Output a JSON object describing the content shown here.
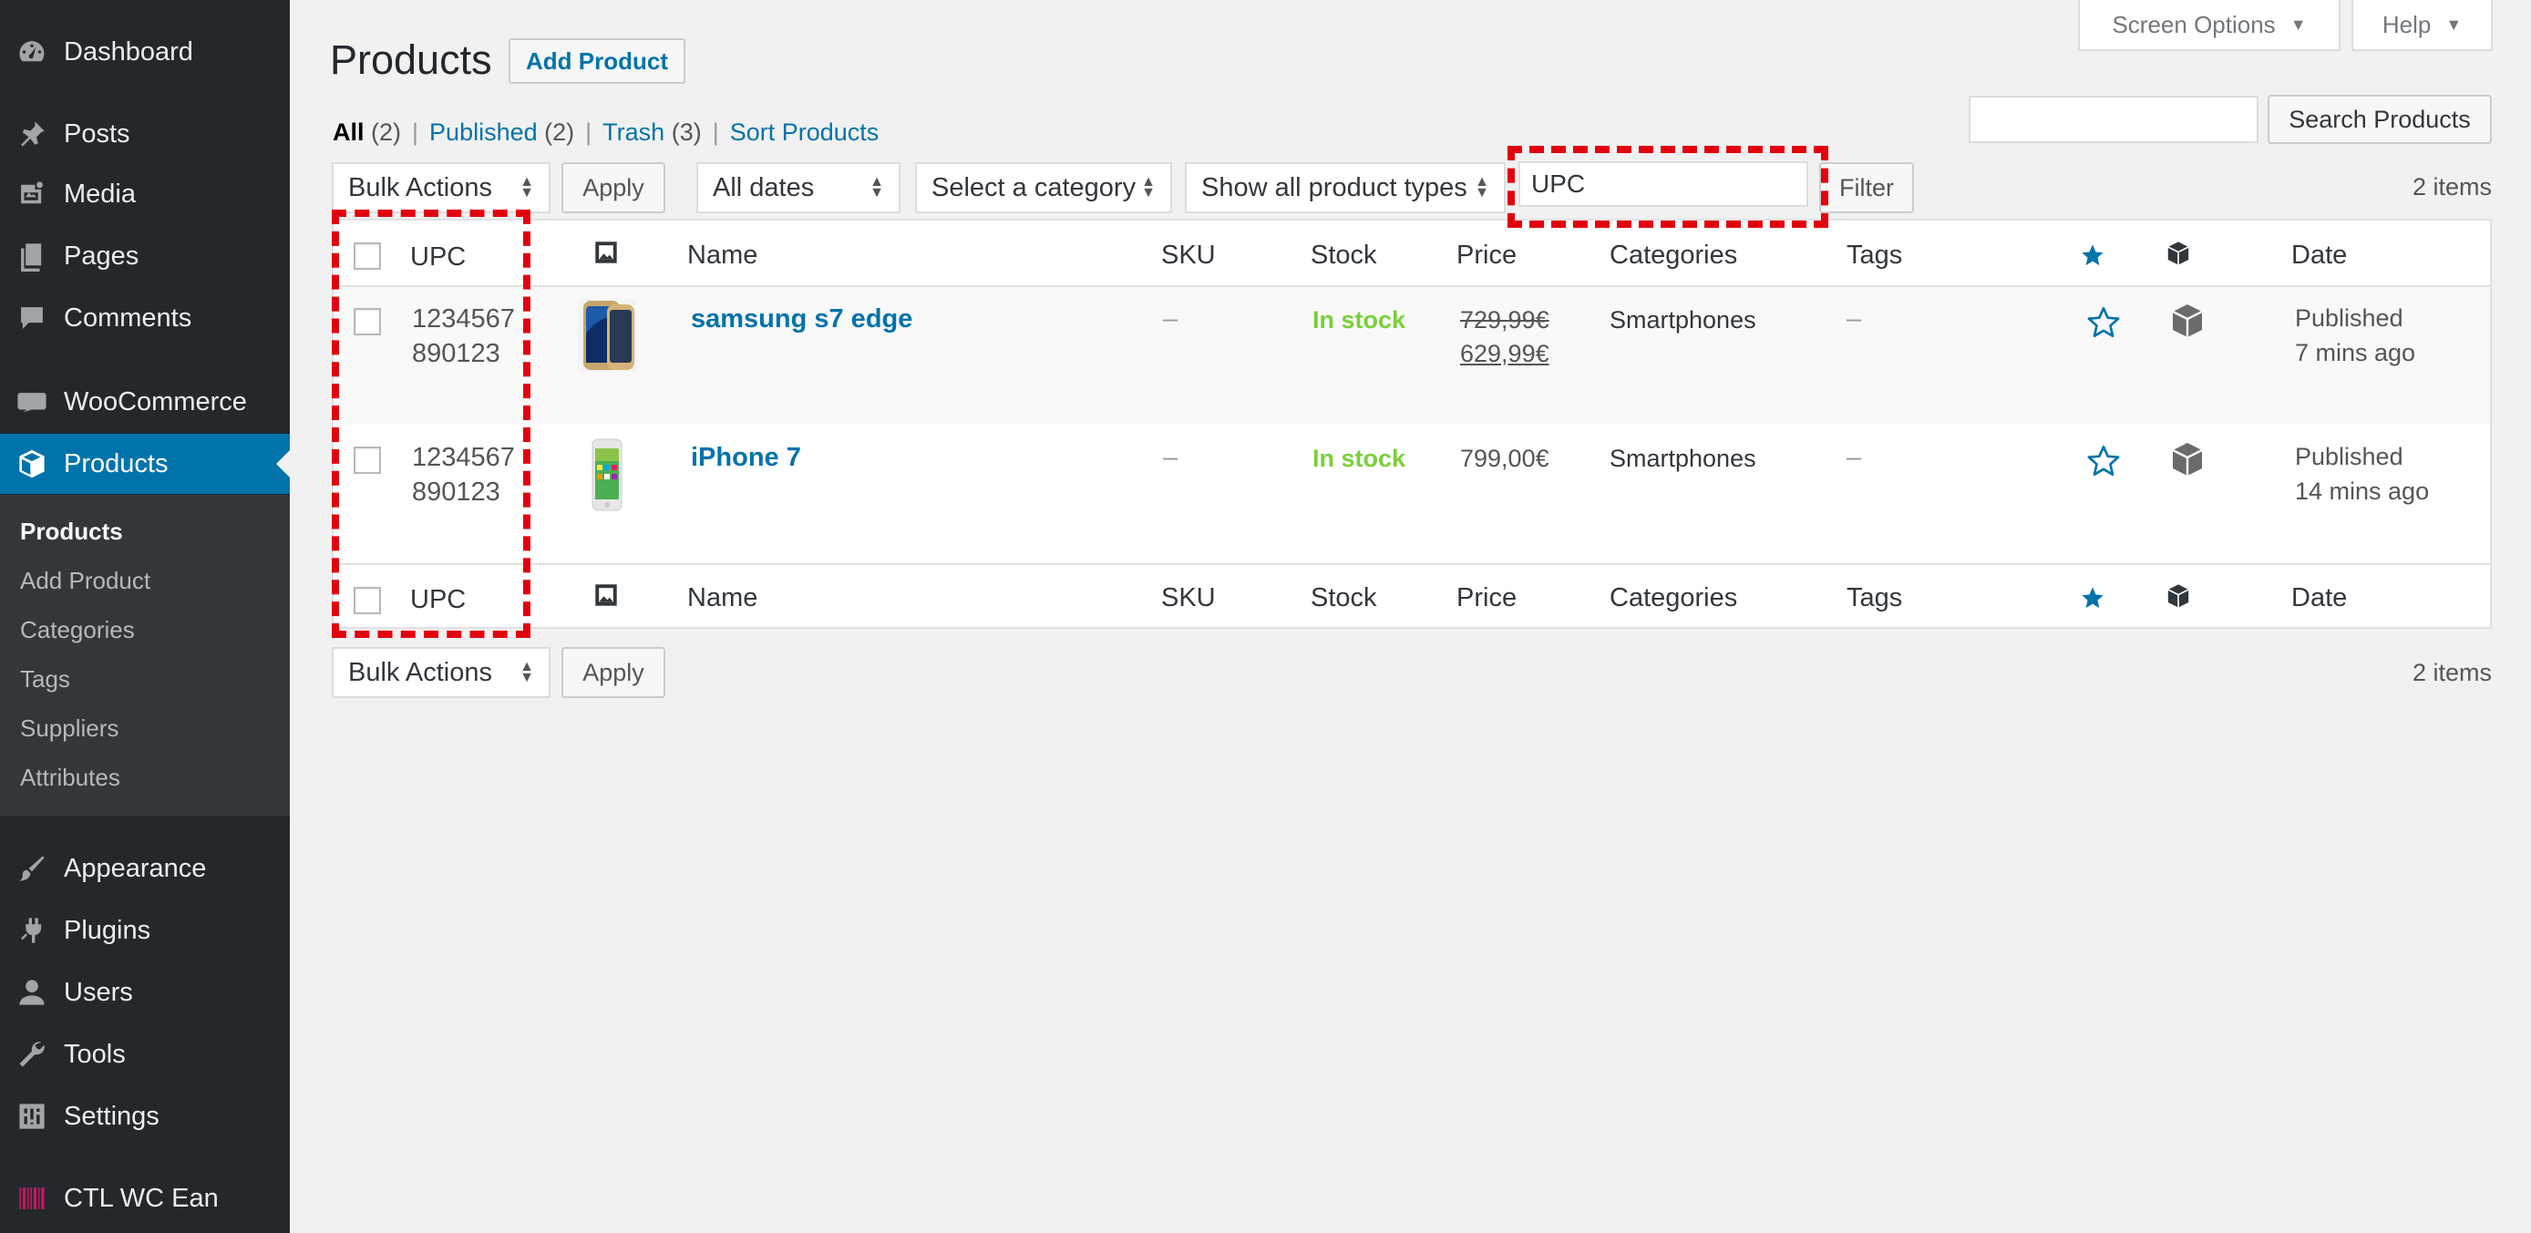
{
  "sidebar": {
    "items": [
      {
        "label": "Dashboard",
        "icon": "dashboard-icon"
      },
      {
        "label": "Posts",
        "icon": "pin-icon"
      },
      {
        "label": "Media",
        "icon": "media-icon"
      },
      {
        "label": "Pages",
        "icon": "pages-icon"
      },
      {
        "label": "Comments",
        "icon": "comment-icon"
      },
      {
        "label": "WooCommerce",
        "icon": "woocommerce-icon"
      },
      {
        "label": "Products",
        "icon": "products-icon"
      },
      {
        "label": "Appearance",
        "icon": "brush-icon"
      },
      {
        "label": "Plugins",
        "icon": "plugin-icon"
      },
      {
        "label": "Users",
        "icon": "user-icon"
      },
      {
        "label": "Tools",
        "icon": "wrench-icon"
      },
      {
        "label": "Settings",
        "icon": "settings-icon"
      },
      {
        "label": "CTL WC Ean",
        "icon": "barcode-icon"
      }
    ],
    "submenu": [
      "Products",
      "Add Product",
      "Categories",
      "Tags",
      "Suppliers",
      "Attributes"
    ]
  },
  "header": {
    "title": "Products",
    "add_product": "Add Product",
    "screen_options": "Screen Options",
    "help": "Help",
    "caret": "▼"
  },
  "views": {
    "all": "All",
    "all_count": "(2)",
    "published": "Published",
    "published_count": "(2)",
    "trash": "Trash",
    "trash_count": "(3)",
    "sort": "Sort Products",
    "separator": "|"
  },
  "search": {
    "button": "Search Products",
    "value": ""
  },
  "filters": {
    "bulk_actions": "Bulk Actions",
    "apply": "Apply",
    "dates": "All dates",
    "category": "Select a category",
    "product_types": "Show all product types",
    "upc_value": "UPC",
    "filter": "Filter",
    "items_count": "2 items"
  },
  "table": {
    "headers": {
      "upc": "UPC",
      "name": "Name",
      "sku": "SKU",
      "stock": "Stock",
      "price": "Price",
      "categories": "Categories",
      "tags": "Tags",
      "date": "Date"
    },
    "rows": [
      {
        "upc_line1": "1234567",
        "upc_line2": "890123",
        "name": "samsung s7 edge",
        "sku": "–",
        "stock": "In stock",
        "price_old": "729,99€",
        "price_new": "629,99€",
        "category": "Smartphones",
        "tags": "–",
        "status": "Published",
        "date": "7 mins ago"
      },
      {
        "upc_line1": "1234567",
        "upc_line2": "890123",
        "name": "iPhone 7",
        "sku": "–",
        "stock": "In stock",
        "price": "799,00€",
        "category": "Smartphones",
        "tags": "–",
        "status": "Published",
        "date": "14 mins ago"
      }
    ]
  },
  "colors": {
    "accent": "#0073aa",
    "in_stock": "#7ad03a",
    "annotation": "#e3000f",
    "sidebar": "#23282d"
  }
}
